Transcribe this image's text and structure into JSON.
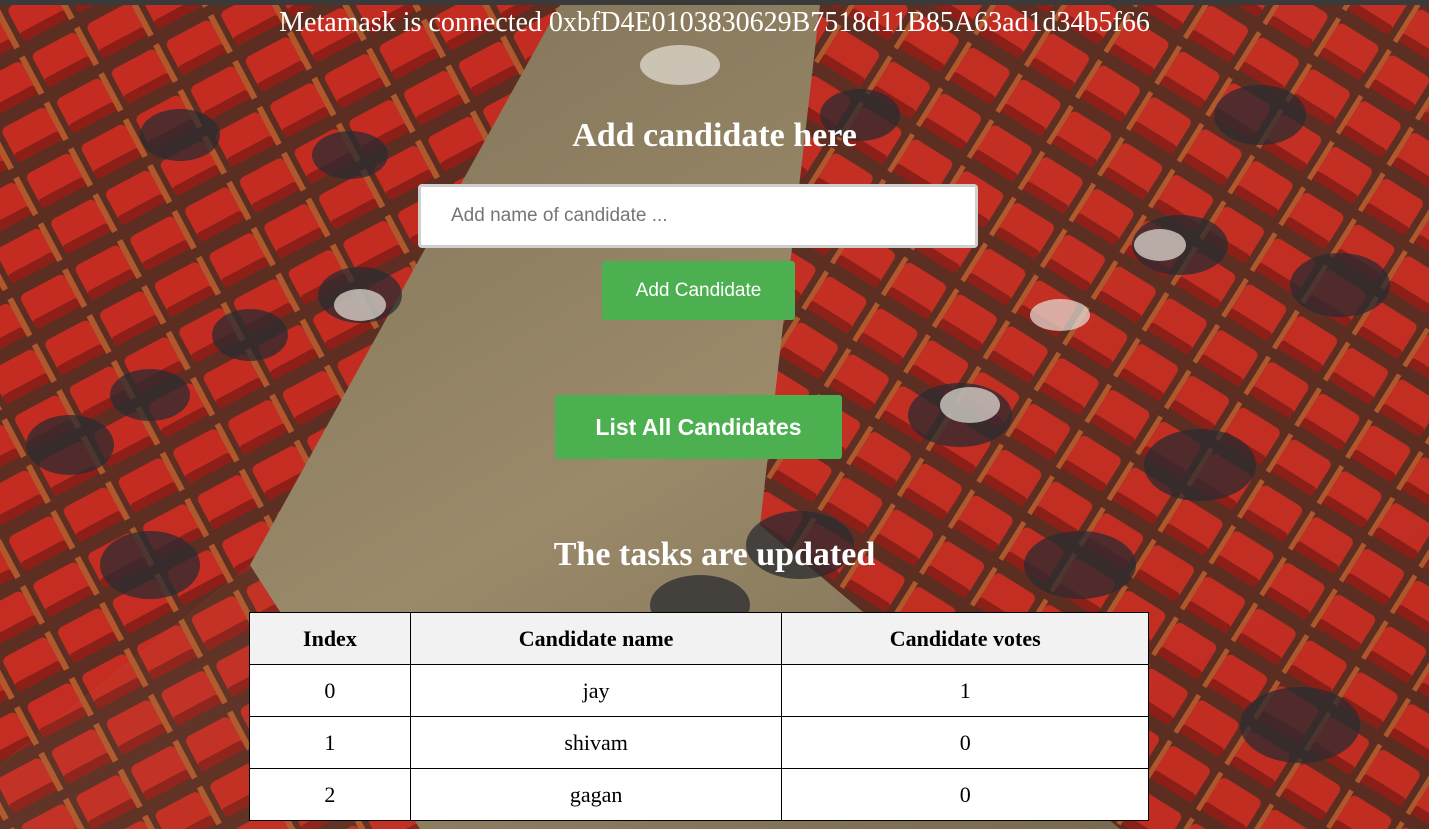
{
  "status": {
    "text": "Metamask is connected 0xbfD4E0103830629B7518d11B85A63ad1d34b5f66"
  },
  "add_section": {
    "heading": "Add candidate here",
    "input_placeholder": "Add name of candidate ...",
    "input_value": "",
    "add_button_label": "Add Candidate"
  },
  "list_button_label": "List All Candidates",
  "results": {
    "heading": "The tasks are updated",
    "columns": [
      "Index",
      "Candidate name",
      "Candidate votes"
    ],
    "rows": [
      [
        "0",
        "jay",
        "1"
      ],
      [
        "1",
        "shivam",
        "0"
      ],
      [
        "2",
        "gagan",
        "0"
      ]
    ]
  },
  "colors": {
    "button_green": "#4caf50",
    "seat_red": "#c8281e",
    "floor_tan": "#8a7a5e"
  },
  "background_image": "auditorium-audience-photo"
}
